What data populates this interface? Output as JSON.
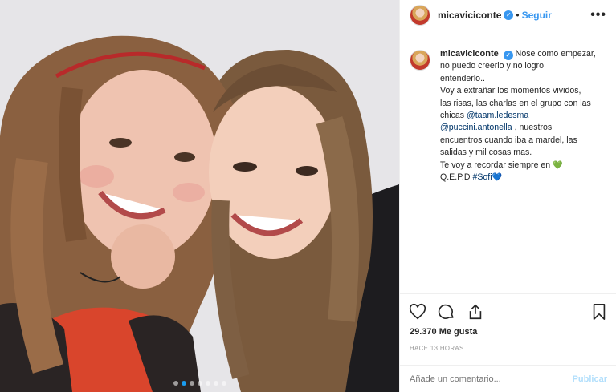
{
  "post": {
    "username": "micaviciconte",
    "verified_mark": "✓",
    "separator": "•",
    "follow_label": "Seguir",
    "more_label": "•••",
    "carousel_dots": 7,
    "carousel_active": 1
  },
  "caption": {
    "username": "micaviciconte",
    "line1_text": "Nose como empezar,",
    "line2": "no puedo creerlo y no logro",
    "line3": "entenderlo..",
    "line4": "Voy a extrañar los momentos vividos,",
    "line5": "las risas, las charlas en el grupo con las",
    "line6_prefix": "chicas",
    "mention1": "@taam.ledesma",
    "mention2": "@puccini.antonella",
    "line7_suffix": ", nuestros",
    "line8": "encuentros cuando iba a mardel, las",
    "line9": "salidas y mil cosas mas.",
    "line10": "Te voy a recordar siempre en",
    "heart_green": "💚",
    "line11_prefix": "Q.E.P.D",
    "hashtag": "#Sofi",
    "heart_blue": "💙"
  },
  "actions": {
    "like_icon": "heart-outline-icon",
    "comment_icon": "comment-bubble-icon",
    "share_icon": "share-icon",
    "save_icon": "bookmark-icon"
  },
  "stats": {
    "likes": "29.370 Me gusta",
    "time": "HACE 13 HORAS"
  },
  "comment_box": {
    "placeholder": "Añade un comentario...",
    "publish_label": "Publicar"
  },
  "colors": {
    "link": "#3897f0",
    "mention": "#003569",
    "publish_disabled": "#b2dffc",
    "green_heart": "#1faa3c"
  }
}
